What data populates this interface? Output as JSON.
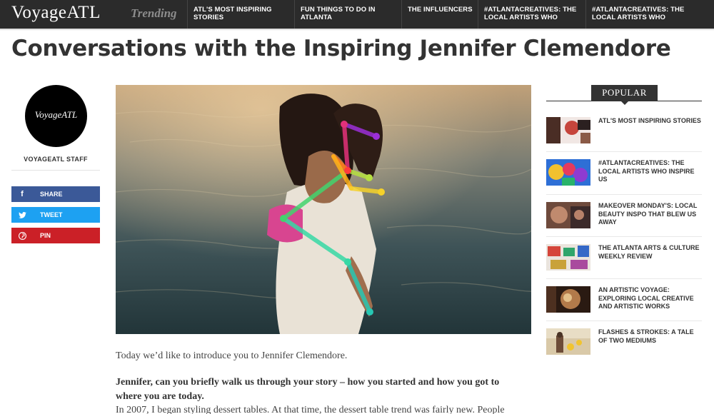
{
  "header": {
    "logo": "VoyageATL",
    "trending_label": "Trending",
    "links": [
      {
        "label": "ATL'S MOST INSPIRING STORIES"
      },
      {
        "label": "FUN THINGS TO DO IN ATLANTA"
      },
      {
        "label": "THE INFLUENCERS"
      },
      {
        "label": "#ATLANTACREATIVES: THE LOCAL ARTISTS WHO"
      },
      {
        "label": "#ATLANTACREATIVES: THE LOCAL ARTISTS WHO"
      }
    ]
  },
  "article": {
    "title": "Conversations with the Inspiring Jennifer Clemendore",
    "intro": "Today we’d like to introduce you to Jennifer Clemendore.",
    "question": "Jennifer, can you briefly walk us through your story – how you started and how you got to where you are today.",
    "answer": "In 2007, I began styling dessert tables. At that time, the dessert table trend was fairly new. People"
  },
  "author": {
    "avatar_text": "VoyageATL",
    "name": "VOYAGEATL STAFF"
  },
  "share": {
    "facebook": "SHARE",
    "twitter": "TWEET",
    "pinterest": "PIN"
  },
  "popular": {
    "heading": "POPULAR",
    "items": [
      {
        "title": "ATL'S MOST INSPIRING STORIES"
      },
      {
        "title": "#ATLANTACREATIVES: THE LOCAL ARTISTS WHO INSPIRE US"
      },
      {
        "title": "MAKEOVER MONDAY'S: LOCAL BEAUTY INSPO THAT BLEW US AWAY"
      },
      {
        "title": "THE ATLANTA ARTS & CULTURE WEEKLY REVIEW"
      },
      {
        "title": "AN ARTISTIC VOYAGE: EXPLORING LOCAL CREATIVE AND ARTISTIC WORKS"
      },
      {
        "title": "FLASHES & STROKES: A TALE OF TWO MEDIUMS"
      }
    ]
  },
  "colors": {
    "nav_bg": "#2b2b2b",
    "facebook": "#3b5998",
    "twitter": "#1da1f2",
    "pinterest": "#cb2027"
  }
}
